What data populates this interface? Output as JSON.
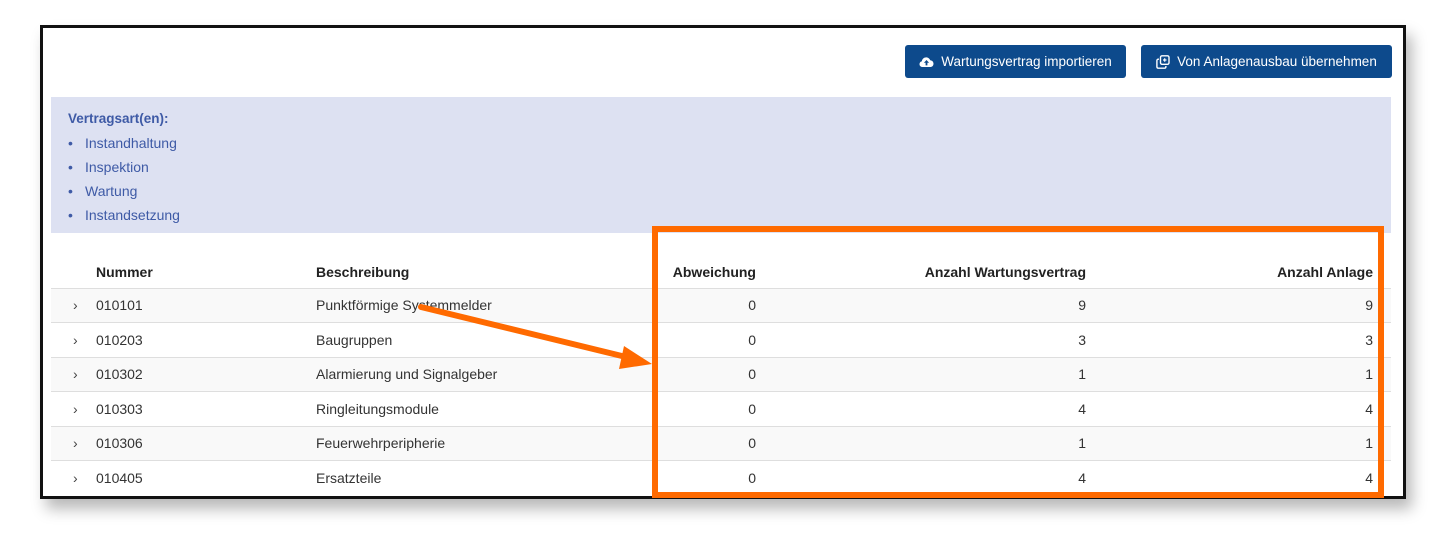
{
  "toolbar": {
    "import_label": "Wartungsvertrag importieren",
    "import_icon": "cloud-upload-icon",
    "copy_label": "Von Anlagenausbau übernehmen",
    "copy_icon": "copy-icon"
  },
  "contract_types": {
    "title": "Vertragsart(en):",
    "items": [
      "Instandhaltung",
      "Inspektion",
      "Wartung",
      "Instandsetzung"
    ]
  },
  "table": {
    "headers": {
      "nummer": "Nummer",
      "beschreibung": "Beschreibung",
      "abweichung": "Abweichung",
      "anzahl_wartungsvertrag": "Anzahl Wartungsvertrag",
      "anzahl_anlage": "Anzahl Anlage"
    },
    "rows": [
      {
        "expand": "›",
        "nummer": "010101",
        "beschreibung": "Punktförmige Systemmelder",
        "abweichung": "0",
        "anzahl_wartungsvertrag": "9",
        "anzahl_anlage": "9"
      },
      {
        "expand": "›",
        "nummer": "010203",
        "beschreibung": "Baugruppen",
        "abweichung": "0",
        "anzahl_wartungsvertrag": "3",
        "anzahl_anlage": "3"
      },
      {
        "expand": "›",
        "nummer": "010302",
        "beschreibung": "Alarmierung und Signalgeber",
        "abweichung": "0",
        "anzahl_wartungsvertrag": "1",
        "anzahl_anlage": "1"
      },
      {
        "expand": "›",
        "nummer": "010303",
        "beschreibung": "Ringleitungsmodule",
        "abweichung": "0",
        "anzahl_wartungsvertrag": "4",
        "anzahl_anlage": "4"
      },
      {
        "expand": "›",
        "nummer": "010306",
        "beschreibung": "Feuerwehrperipherie",
        "abweichung": "0",
        "anzahl_wartungsvertrag": "1",
        "anzahl_anlage": "1"
      },
      {
        "expand": "›",
        "nummer": "010405",
        "beschreibung": "Ersatzteile",
        "abweichung": "0",
        "anzahl_wartungsvertrag": "4",
        "anzahl_anlage": "4"
      }
    ]
  },
  "colors": {
    "button": "#0d4a8c",
    "info_background": "#dde1f2",
    "info_text": "#3e5aa6",
    "annotation": "#ff6a00"
  }
}
